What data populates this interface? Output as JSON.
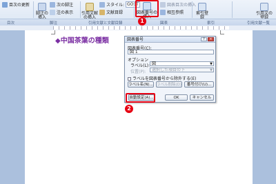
{
  "ribbon": {
    "toc_update": "目次の更新",
    "next_footnote_small": "次の脚注",
    "insert_footnote": "脚注の挿入",
    "show_notes": "注の表示",
    "insert_citation": "引用文献の挿入",
    "style_label": "スタイル:",
    "style_value": "GOST",
    "bibliography": "文献目録",
    "insert_caption": "図表番号の挿入",
    "insert_table_of_figures": "図表目次の挿入",
    "cross_reference": "相互参照",
    "mark_entry": "索引登録",
    "mark_citation": "引用文の登録",
    "groups": {
      "toc": "目次",
      "footnotes": "脚注",
      "citations": "引用文献と文献目録",
      "captions": "図表",
      "index": "索引",
      "toa": "引用文献一覧"
    }
  },
  "document": {
    "heading": "◆中国茶葉の種類"
  },
  "dialog": {
    "title": "図表番号",
    "caption_label": "図表番号(C):",
    "caption_value": "図 1",
    "options_label": "オプション",
    "label_label": "ラベル(L):",
    "label_value": "図",
    "position_label": "位置(P):",
    "position_value": "選択した項目の下",
    "exclude_label": "ラベルを図表番号から除外する(E)",
    "new_label_button": "ラベル名(N)...",
    "delete_label_button": "ラベル削除(D)",
    "numbering_button": "番号付け(U)...",
    "autocaption_button": "自動設定(A)...",
    "ok_button": "OK",
    "cancel_button": "キャンセル",
    "help_icon": "?",
    "close_icon": "×"
  },
  "annotations": {
    "step1": "1",
    "step2": "2"
  },
  "colors": {
    "highlight": "#e60012",
    "heading": "#7b2fa3"
  }
}
